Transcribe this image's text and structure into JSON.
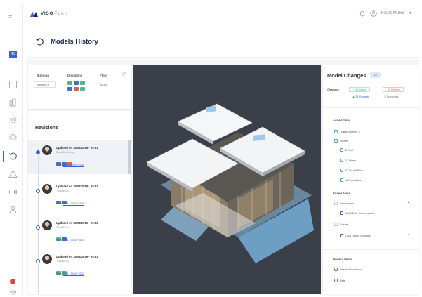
{
  "app": {
    "logo_bold": "VISO",
    "logo_light": "PLAN"
  },
  "user": {
    "name": "Franz Müller"
  },
  "rail": {
    "workspace_badge": "RS"
  },
  "page": {
    "title": "Models History"
  },
  "filters": {
    "building_label": "Building",
    "discipline_label": "Discipline",
    "floor_label": "Floor",
    "building_value": "Building D",
    "floor_value": "2030",
    "discipline_chips": [
      "green",
      "blue",
      "green",
      "blue",
      "red",
      "green"
    ]
  },
  "revisions": {
    "title": "Revisions",
    "items": [
      {
        "updated": "Updated on 28.08.2019 - 09:33",
        "user": "Burst Dantelnap",
        "row": "Row:",
        "row_link": "0001 / 0002 / 0003"
      },
      {
        "updated": "Updated on 28.08.2019 - 09:33",
        "user": "Tona Bollet",
        "row": "Row:",
        "row_link": "0001 / 0002 / 0003"
      },
      {
        "updated": "Updated on 28.08.2019 - 09:33",
        "user": "Tona Bollet",
        "row": "Row:",
        "row_link": "0001 / 0002 / 0003"
      },
      {
        "updated": "Updated on 28.08.2019 - 09:33",
        "user": "Tona Bollet",
        "row": "Row:",
        "row_link": "0001 / 0002 / 0003"
      }
    ]
  },
  "changes": {
    "title": "Model Changes",
    "count": "12",
    "changes_label": "Changes",
    "added_pill": "+ 34 Added",
    "deleted_pill": "- 34 Deleted",
    "elements_pill": "▲ 23 Elements",
    "properties_pill": "☐ Properties",
    "added_title": "Added Items",
    "added_items": [
      "Training Series 3",
      "Stories",
      "2.Roof",
      "1.Gallery",
      "0.Ground Floor",
      "-1 Foundation"
    ],
    "edited_title": "Edited Items",
    "edited_items": [
      "Worksheets",
      "W-01 Doc. Independent",
      "Sheets",
      "D-01 Detail (Drawing)"
    ],
    "deleted_title": "Deleted Items",
    "deleted_items": [
      "Interior Elevations",
      "Lists"
    ]
  },
  "colors": {
    "accent": "#3b5fd6",
    "added": "#4ab88a",
    "deleted": "#e05a5a",
    "viewer_bg": "#3a3f4a"
  }
}
